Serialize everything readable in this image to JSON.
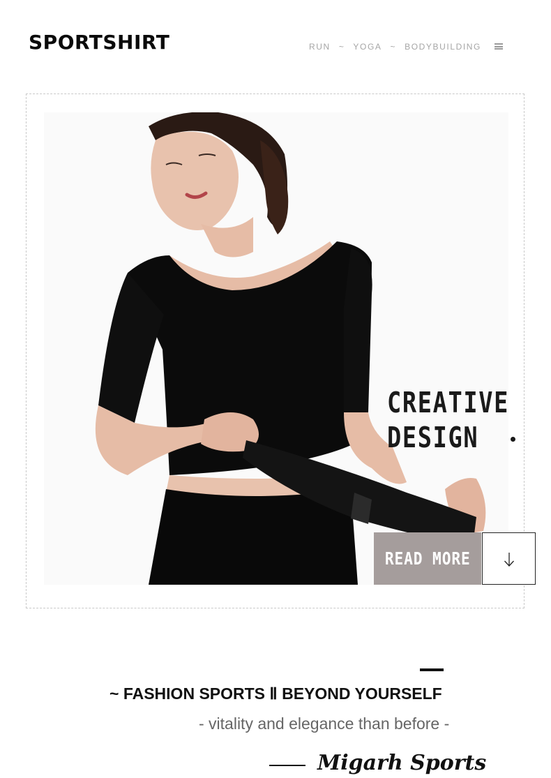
{
  "header": {
    "brand": "SPORTSHIRT",
    "nav": [
      "RUN",
      "YOGA",
      "BODYBUILDING"
    ],
    "separator": "~",
    "menu_icon": "hamburger-menu-icon"
  },
  "hero": {
    "headline_line1": "CREATIVE",
    "headline_line2": "DESIGN",
    "read_more": "READ MORE",
    "arrow_icon": "arrow-down-icon",
    "image": "woman in black half-sleeve sport shirt"
  },
  "footer": {
    "tagline": "~ FASHION SPORTS Ⅱ BEYOND YOURSELF",
    "subtagline": "- vitality and elegance than before -",
    "signature": "Migarh Sports"
  },
  "colors": {
    "accent_button": "#a59d9c",
    "text_dark": "#111111",
    "nav_gray": "#a5a5a5"
  }
}
